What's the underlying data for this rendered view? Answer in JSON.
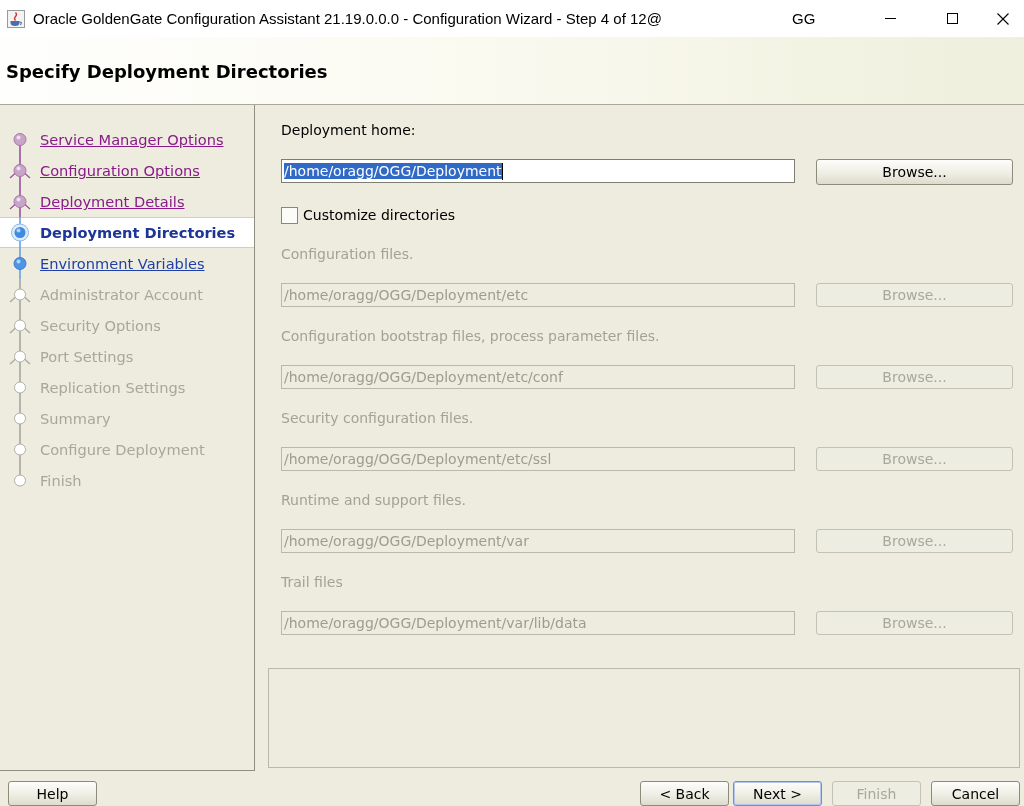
{
  "window": {
    "title": "Oracle GoldenGate Configuration Assistant 21.19.0.0.0 - Configuration Wizard - Step 4 of 12@",
    "title_suffix": "GG"
  },
  "header": {
    "title": "Specify Deployment Directories"
  },
  "sidebar": {
    "items": [
      {
        "label": "Service Manager Options",
        "kind": "step",
        "visited": true,
        "enabled": true,
        "selected": false
      },
      {
        "label": "Configuration Options",
        "kind": "branch",
        "visited": true,
        "enabled": true,
        "selected": false
      },
      {
        "label": "Deployment Details",
        "kind": "branch",
        "visited": true,
        "enabled": true,
        "selected": false
      },
      {
        "label": "Deployment Directories",
        "kind": "step",
        "visited": false,
        "enabled": true,
        "selected": true
      },
      {
        "label": "Environment Variables",
        "kind": "step",
        "visited": false,
        "enabled": true,
        "selected": false
      },
      {
        "label": "Administrator Account",
        "kind": "branch",
        "visited": false,
        "enabled": false,
        "selected": false
      },
      {
        "label": "Security Options",
        "kind": "branch",
        "visited": false,
        "enabled": false,
        "selected": false
      },
      {
        "label": "Port Settings",
        "kind": "branch",
        "visited": false,
        "enabled": false,
        "selected": false
      },
      {
        "label": "Replication Settings",
        "kind": "step",
        "visited": false,
        "enabled": false,
        "selected": false
      },
      {
        "label": "Summary",
        "kind": "step",
        "visited": false,
        "enabled": false,
        "selected": false
      },
      {
        "label": "Configure Deployment",
        "kind": "step",
        "visited": false,
        "enabled": false,
        "selected": false
      },
      {
        "label": "Finish",
        "kind": "step",
        "visited": false,
        "enabled": false,
        "selected": false
      }
    ]
  },
  "form": {
    "home": {
      "label": "Deployment home:",
      "value": "/home/oragg/OGG/Deployment",
      "text_selected": true,
      "disabled": false,
      "browse": {
        "label": "Browse...",
        "disabled": false
      }
    },
    "customize": {
      "label": "Customize directories",
      "checked": false
    },
    "directories": [
      {
        "label": "Configuration files.",
        "value": "/home/oragg/OGG/Deployment/etc",
        "disabled": true,
        "browse": {
          "label": "Browse...",
          "disabled": true
        }
      },
      {
        "label": "Configuration bootstrap files, process parameter files.",
        "value": "/home/oragg/OGG/Deployment/etc/conf",
        "disabled": true,
        "browse": {
          "label": "Browse...",
          "disabled": true
        }
      },
      {
        "label": "Security configuration files.",
        "value": "/home/oragg/OGG/Deployment/etc/ssl",
        "disabled": true,
        "browse": {
          "label": "Browse...",
          "disabled": true
        }
      },
      {
        "label": "Runtime and support files.",
        "value": "/home/oragg/OGG/Deployment/var",
        "disabled": true,
        "browse": {
          "label": "Browse...",
          "disabled": true
        }
      },
      {
        "label": "Trail files",
        "value": "/home/oragg/OGG/Deployment/var/lib/data",
        "disabled": true,
        "browse": {
          "label": "Browse...",
          "disabled": true
        }
      }
    ]
  },
  "footer": {
    "left_buttons": [
      {
        "label": "Help",
        "disabled": false,
        "focused": false
      }
    ],
    "right_buttons": [
      {
        "label": "< Back",
        "disabled": false,
        "focused": false
      },
      {
        "label": "Next >",
        "disabled": false,
        "focused": true
      },
      {
        "label": "Finish",
        "disabled": true,
        "focused": false
      },
      {
        "label": "Cancel",
        "disabled": false,
        "focused": false
      }
    ]
  }
}
